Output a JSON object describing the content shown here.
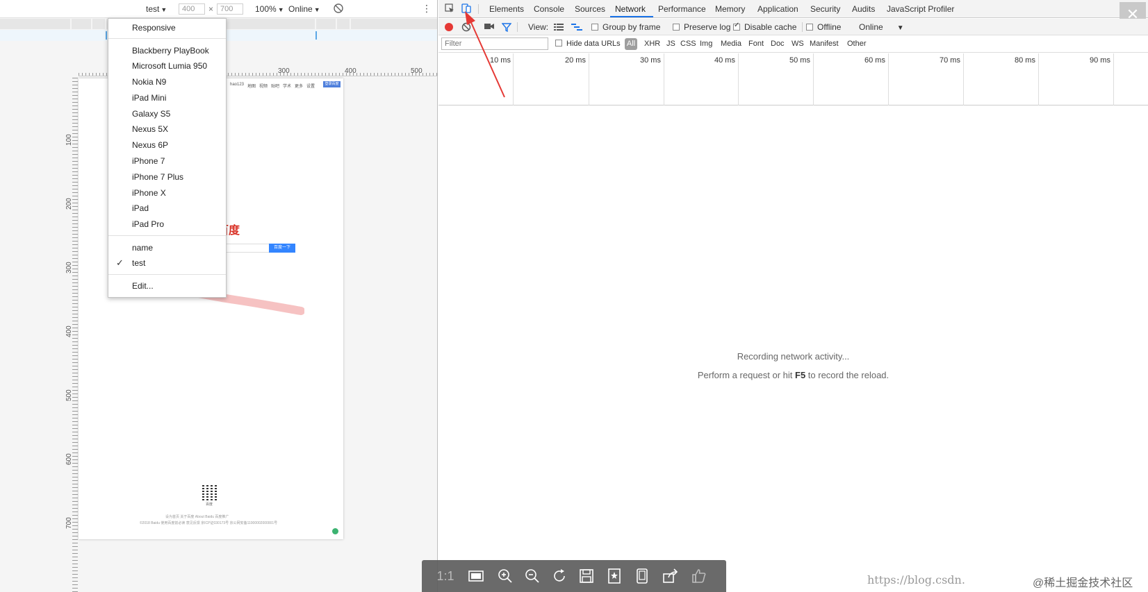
{
  "device_toolbar": {
    "device_name": "test",
    "width": "400",
    "times": "×",
    "height": "700",
    "zoom": "100%",
    "throttle": "Online",
    "caret": "▼",
    "rotate_icon": "rotate-icon",
    "more_icon": "⋮"
  },
  "rulers": {
    "top": [
      "300",
      "400",
      "500"
    ],
    "left": [
      "100",
      "200",
      "300",
      "400",
      "500",
      "600",
      "700"
    ]
  },
  "device_page": {
    "nav_links": [
      "hao123",
      "地图",
      "视频",
      "贴吧",
      "学术",
      "更多",
      "设置"
    ],
    "nav_badge": "登录百度",
    "logo_fragment": "百度",
    "search_button": "百度一下",
    "qr_caption": "百度",
    "footer_line_1": "设为首页  关于百度  About Baidu  百度推广",
    "footer_line_2": "©2018 Baidu 使用百度前必读 意见反馈 京ICP证030173号  京公网安备11000002000001号"
  },
  "device_menu": {
    "responsive": "Responsive",
    "devices": [
      "Blackberry PlayBook",
      "Microsoft Lumia 950",
      "Nokia N9",
      "iPad Mini",
      "Galaxy S5",
      "Nexus 5X",
      "Nexus 6P",
      "iPhone 7",
      "iPhone 7 Plus",
      "iPhone X",
      "iPad",
      "iPad Pro"
    ],
    "custom": [
      "name",
      "test"
    ],
    "selected": "test",
    "edit": "Edit..."
  },
  "devtools": {
    "tabs": [
      "Elements",
      "Console",
      "Sources",
      "Network",
      "Performance",
      "Memory",
      "Application",
      "Security",
      "Audits",
      "JavaScript Profiler"
    ],
    "active_tab": "Network",
    "close_icon": "✕",
    "toolbar": {
      "view_label": "View:",
      "group_by_frame": "Group by frame",
      "preserve_log": "Preserve log",
      "disable_cache": "Disable cache",
      "offline": "Offline",
      "throttle": "Online",
      "caret": "▼"
    },
    "filter": {
      "placeholder": "Filter",
      "hide_data_urls": "Hide data URLs",
      "types": [
        "All",
        "XHR",
        "JS",
        "CSS",
        "Img",
        "Media",
        "Font",
        "Doc",
        "WS",
        "Manifest",
        "Other"
      ]
    },
    "timeline_labels": [
      "10 ms",
      "20 ms",
      "30 ms",
      "40 ms",
      "50 ms",
      "60 ms",
      "70 ms",
      "80 ms",
      "90 ms"
    ],
    "empty": {
      "line1": "Recording network activity...",
      "line2_prefix": "Perform a request or hit ",
      "line2_key": "F5",
      "line2_suffix": " to record the reload."
    }
  },
  "viewer_toolbar": {
    "actual_size": "1:1"
  },
  "watermark": {
    "url": "https://blog.csdn.",
    "text": "@稀土掘金技术社区"
  },
  "colors": {
    "accent": "#1a73e8",
    "record_red": "#e53935",
    "arrow_red": "#e53935"
  }
}
